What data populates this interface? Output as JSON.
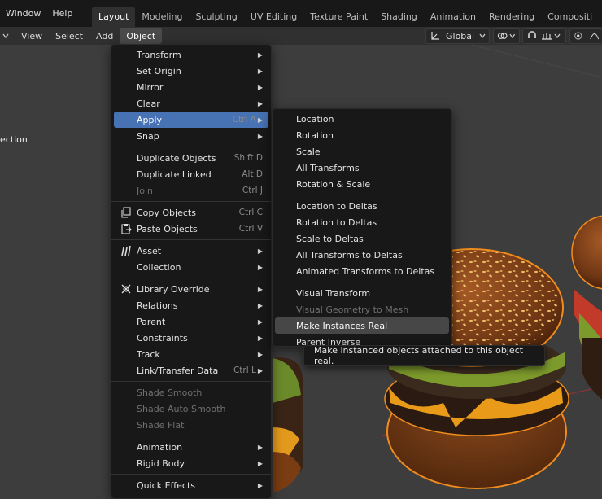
{
  "topbar": {
    "menus": [
      "Window",
      "Help"
    ],
    "workspaces": [
      "Layout",
      "Modeling",
      "Sculpting",
      "UV Editing",
      "Texture Paint",
      "Shading",
      "Animation",
      "Rendering",
      "Compositi"
    ]
  },
  "view_header": {
    "menus": [
      "View",
      "Select",
      "Add",
      "Object"
    ],
    "orientation": "Global"
  },
  "viewport": {
    "edge_label": "ection"
  },
  "object_menu": {
    "groups": [
      [
        {
          "label": "Transform",
          "arrow": true
        },
        {
          "label": "Set Origin",
          "arrow": true
        },
        {
          "label": "Mirror",
          "arrow": true
        },
        {
          "label": "Clear",
          "arrow": true
        },
        {
          "label": "Apply",
          "shortcut": "Ctrl A",
          "arrow": true,
          "state": "open"
        },
        {
          "label": "Snap",
          "arrow": true
        }
      ],
      [
        {
          "label": "Duplicate Objects",
          "shortcut": "Shift D"
        },
        {
          "label": "Duplicate Linked",
          "shortcut": "Alt D"
        },
        {
          "label": "Join",
          "shortcut": "Ctrl J",
          "disabled": true
        }
      ],
      [
        {
          "label": "Copy Objects",
          "shortcut": "Ctrl C",
          "icon": "copy-icon"
        },
        {
          "label": "Paste Objects",
          "shortcut": "Ctrl V",
          "icon": "paste-icon"
        }
      ],
      [
        {
          "label": "Asset",
          "arrow": true,
          "icon": "asset-icon"
        },
        {
          "label": "Collection",
          "arrow": true
        }
      ],
      [
        {
          "label": "Library Override",
          "arrow": true,
          "icon": "library-override-icon"
        },
        {
          "label": "Relations",
          "arrow": true
        },
        {
          "label": "Parent",
          "arrow": true
        },
        {
          "label": "Constraints",
          "arrow": true
        },
        {
          "label": "Track",
          "arrow": true
        },
        {
          "label": "Link/Transfer Data",
          "shortcut": "Ctrl L",
          "arrow": true
        }
      ],
      [
        {
          "label": "Shade Smooth",
          "disabled": true
        },
        {
          "label": "Shade Auto Smooth",
          "disabled": true
        },
        {
          "label": "Shade Flat",
          "disabled": true
        }
      ],
      [
        {
          "label": "Animation",
          "arrow": true
        },
        {
          "label": "Rigid Body",
          "arrow": true
        }
      ],
      [
        {
          "label": "Quick Effects",
          "arrow": true
        }
      ]
    ]
  },
  "apply_menu": {
    "groups": [
      [
        {
          "label": "Location"
        },
        {
          "label": "Rotation"
        },
        {
          "label": "Scale"
        },
        {
          "label": "All Transforms"
        },
        {
          "label": "Rotation & Scale"
        }
      ],
      [
        {
          "label": "Location to Deltas"
        },
        {
          "label": "Rotation to Deltas"
        },
        {
          "label": "Scale to Deltas"
        },
        {
          "label": "All Transforms to Deltas"
        },
        {
          "label": "Animated Transforms to Deltas"
        }
      ],
      [
        {
          "label": "Visual Transform"
        },
        {
          "label": "Visual Geometry to Mesh",
          "disabled": true
        },
        {
          "label": "Make Instances Real",
          "state": "hover"
        },
        {
          "label": "Parent Inverse"
        }
      ]
    ]
  },
  "tooltip": {
    "text": "Make instanced objects attached to this object real."
  },
  "colors": {
    "accent": "#4772b3",
    "selection_outline": "#f08c1e",
    "menu_bg": "#181818"
  }
}
